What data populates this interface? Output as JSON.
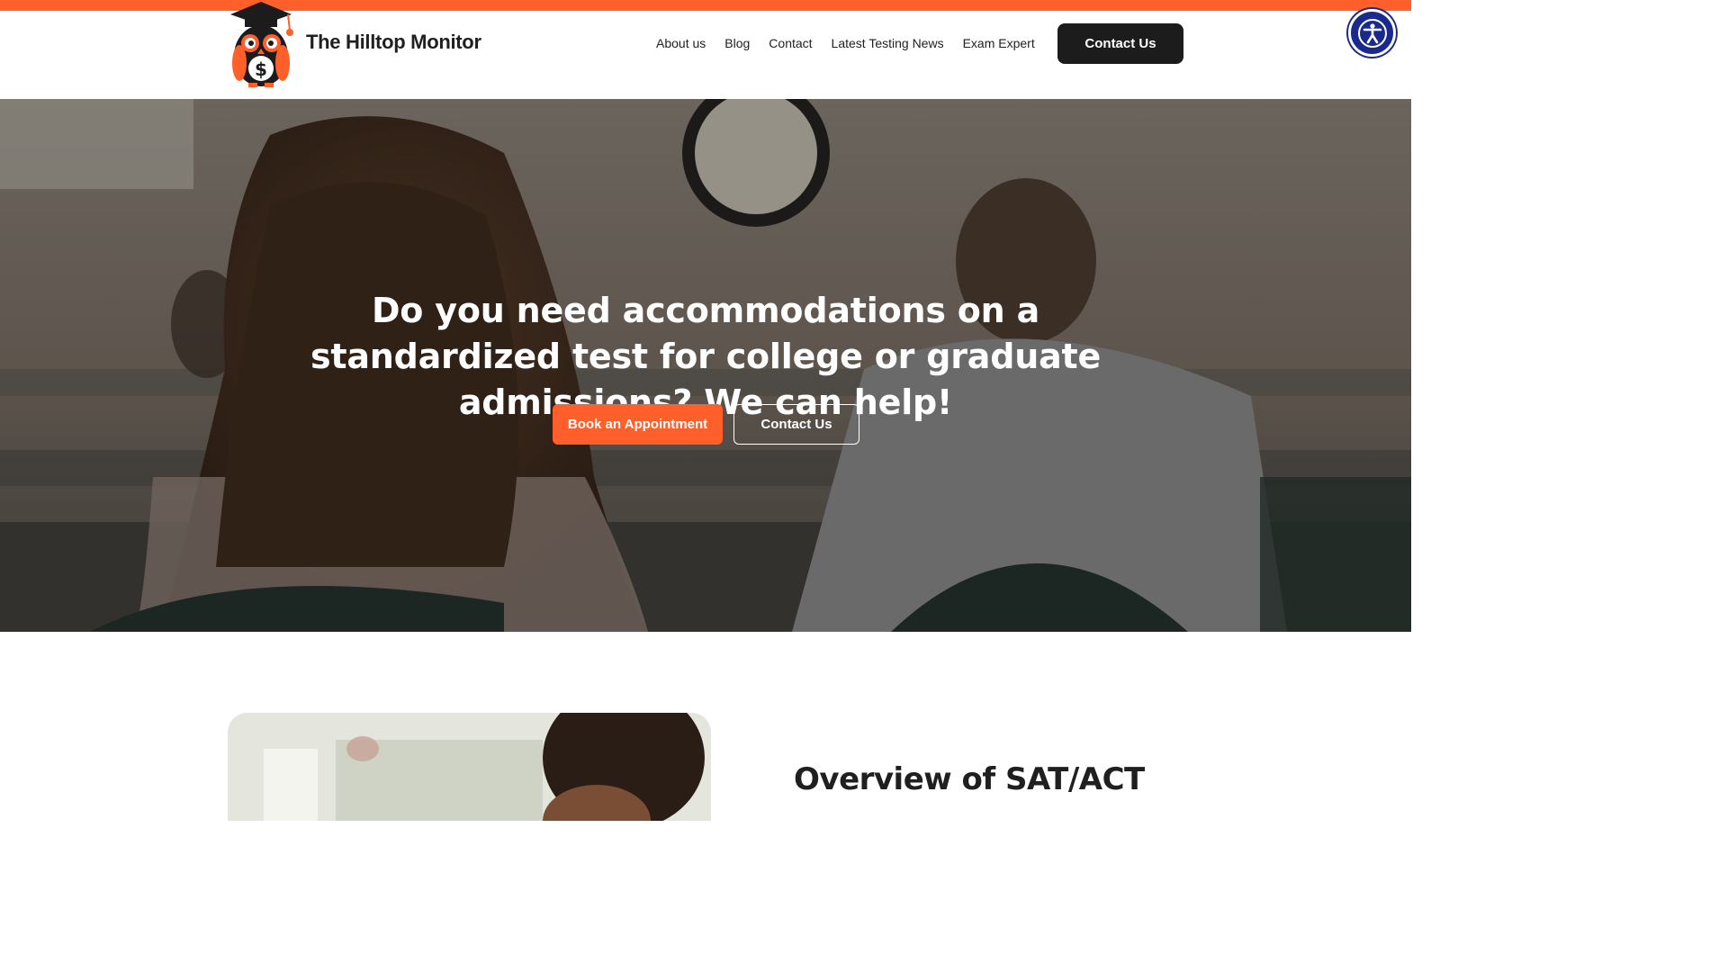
{
  "site": {
    "brand_name": "The Hilltop Monitor",
    "accent_color": "#ff5f2a",
    "dark_color": "#1c1c1c",
    "logo_icon": "owl-graduate-icon"
  },
  "nav": {
    "items": [
      {
        "label": "About us"
      },
      {
        "label": "Blog"
      },
      {
        "label": "Contact"
      },
      {
        "label": "Latest Testing News"
      },
      {
        "label": "Exam Expert"
      }
    ],
    "cta_label": "Contact Us"
  },
  "accessibility": {
    "icon": "accessibility-icon",
    "color": "#1a2a8c"
  },
  "hero": {
    "title": "Do you need accommodations on a standardized test for college or graduate admissions? We can help!",
    "primary_button": "Book an Appointment",
    "secondary_button": "Contact Us"
  },
  "overview": {
    "title": "Overview of SAT/ACT"
  }
}
